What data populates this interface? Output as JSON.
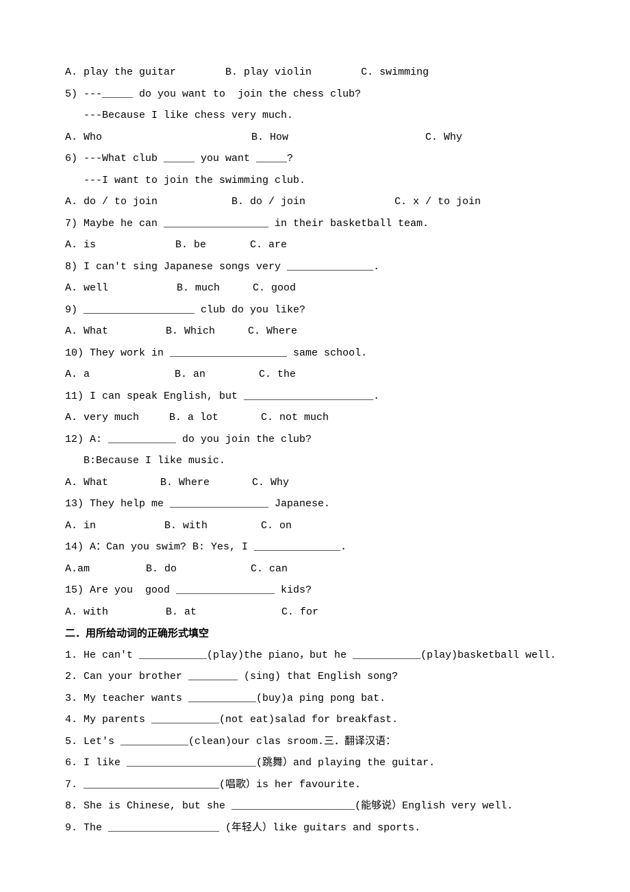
{
  "q4_opts": {
    "a": "A. play the guitar",
    "b": "B. play violin",
    "c": "C. swimming"
  },
  "q5": {
    "line1": "5) ---_____ do you want to  join the chess club?",
    "line2": "---Because I like chess very much.",
    "a": "A. Who",
    "b": "B. How",
    "c": "C. Why"
  },
  "q6": {
    "line1": "6) ---What club _____ you want _____?",
    "line2": "---I want to join the swimming club.",
    "a": "A. do / to join",
    "b": "B. do / join",
    "c": "C. x / to join"
  },
  "q7": {
    "line1": "7) Maybe he can _________________ in their basketball team.",
    "a": "A. is",
    "b": "B. be",
    "c": "C. are"
  },
  "q8": {
    "line1": "8) I can't sing Japanese songs very ______________.",
    "a": "A. well",
    "b": "B. much",
    "c": "C. good"
  },
  "q9": {
    "line1": "9) __________________ club do you like?",
    "a": "A. What",
    "b": "B. Which",
    "c": "C. Where"
  },
  "q10": {
    "line1": "10) They work in ___________________ same school.",
    "a": "A. a",
    "b": "B. an",
    "c": "C. the"
  },
  "q11": {
    "line1": "11) I can speak English, but _____________________.",
    "a": "A. very much",
    "b": "B. a lot",
    "c": "C. not much"
  },
  "q12": {
    "line1": "12) A: ___________ do you join the club?",
    "line2": "B:Because I like music.",
    "a": "A. What",
    "b": "B. Where",
    "c": "C. Why"
  },
  "q13": {
    "line1": "13) They help me ________________ Japanese.",
    "a": "A. in",
    "b": "B. with",
    "c": "C. on"
  },
  "q14": {
    "line1": "14) A：Can you swim? B: Yes, I ______________.",
    "a": "A.am",
    "b": "B. do",
    "c": "C. can"
  },
  "q15": {
    "line1": "15) Are you  good ________________ kids?",
    "a": "A. with",
    "b": "B. at",
    "c": "C. for"
  },
  "section2": {
    "heading": "二．用所给动词的正确形式填空",
    "items": [
      "1. He can't ___________(play)the piano，but he ___________(play)basketball well.",
      "2. Can your brother ________ (sing) that English song?",
      "3. My teacher wants ___________(buy)a ping pong bat.",
      "4. My parents ___________(not eat)salad for breakfast.",
      "5. Let's ___________(clean)our clas sroom.三．翻译汉语：",
      "6. I like _____________________(跳舞）and playing the guitar.",
      "7. ______________________(唱歌）is her favourite.",
      "8. She is Chinese, but she ____________________(能够说）English very well.",
      "9. The __________________ (年轻人）like guitars and sports."
    ]
  }
}
